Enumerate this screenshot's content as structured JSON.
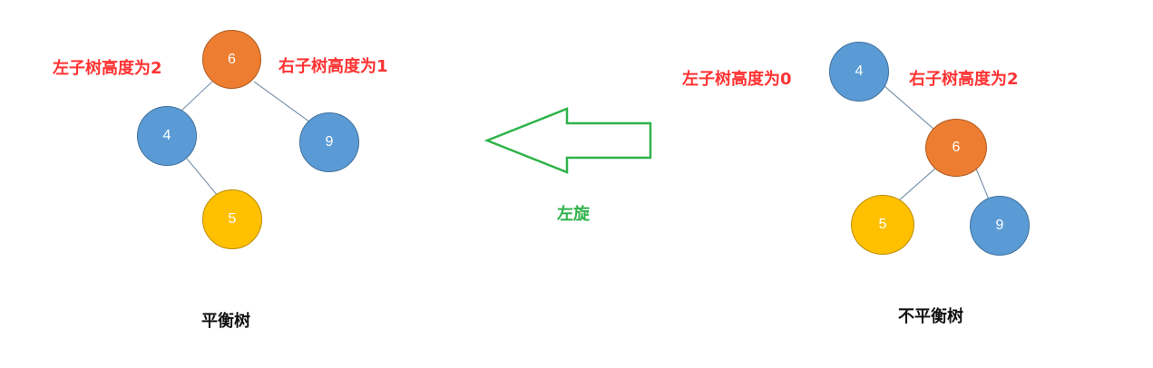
{
  "colors": {
    "blue": "#5b9bd5",
    "orange": "#ed7d31",
    "yellow": "#ffc000",
    "edge": "#7f96ad",
    "arrow": "#2fb34a",
    "annotation": "#ff3333",
    "caption": "#111111"
  },
  "balanced_tree": {
    "caption": "平衡树",
    "left_height_note": "左子树高度为2",
    "right_height_note": "右子树高度为1",
    "nodes": {
      "root": "6",
      "left": "4",
      "right": "9",
      "left_right": "5"
    }
  },
  "rotation": {
    "label": "左旋",
    "arrow_icon": "arrow-left-icon"
  },
  "unbalanced_tree": {
    "caption": "不平衡树",
    "left_height_note": "左子树高度为0",
    "right_height_note": "右子树高度为2",
    "nodes": {
      "root": "4",
      "right": "6",
      "right_left": "5",
      "right_right": "9"
    }
  }
}
